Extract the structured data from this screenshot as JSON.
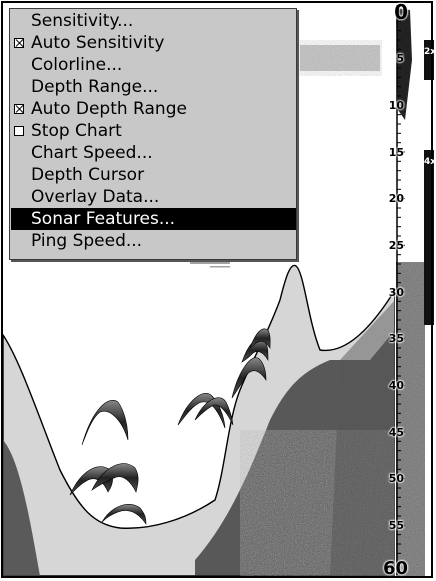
{
  "menu": {
    "items": [
      {
        "label": "Sensitivity...",
        "checkbox": null,
        "selected": false
      },
      {
        "label": "Auto Sensitivity",
        "checkbox": "checked",
        "selected": false
      },
      {
        "label": "Colorline...",
        "checkbox": null,
        "selected": false
      },
      {
        "label": "Depth Range...",
        "checkbox": null,
        "selected": false
      },
      {
        "label": "Auto Depth Range",
        "checkbox": "checked",
        "selected": false
      },
      {
        "label": "Stop Chart",
        "checkbox": "unchecked",
        "selected": false
      },
      {
        "label": "Chart Speed...",
        "checkbox": null,
        "selected": false
      },
      {
        "label": "Depth Cursor",
        "checkbox": null,
        "selected": false
      },
      {
        "label": "Overlay Data...",
        "checkbox": null,
        "selected": false
      },
      {
        "label": "Sonar Features...",
        "checkbox": null,
        "selected": true
      },
      {
        "label": "Ping Speed...",
        "checkbox": null,
        "selected": false
      }
    ]
  },
  "depth_scale": {
    "labels": [
      "0",
      "5",
      "10",
      "15",
      "20",
      "25",
      "30",
      "35",
      "40",
      "45",
      "50",
      "55",
      "60"
    ],
    "max": 60
  },
  "zoom_bar": {
    "tags": [
      "2x",
      "4x"
    ]
  },
  "colors": {
    "menu_bg": "#c8c8c8",
    "menu_selected_bg": "#000000",
    "bottom_fill": "#d4d4d4",
    "water": "#ffffff"
  }
}
